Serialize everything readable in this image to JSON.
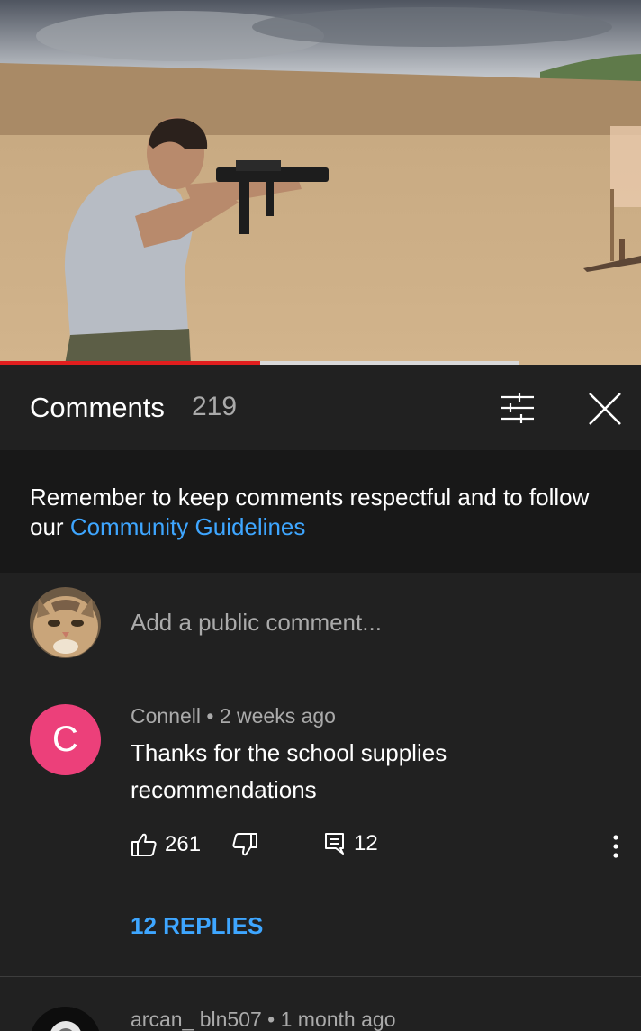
{
  "video": {
    "progress": 0.406,
    "buffered": 0.809
  },
  "comments_header": {
    "title": "Comments",
    "count": "219",
    "filter_icon": "filter-sliders-icon",
    "close_icon": "close-icon"
  },
  "notice": {
    "text": "Remember to keep comments respectful and to follow our ",
    "link": "Community Guidelines"
  },
  "add_comment": {
    "placeholder": "Add a public comment..."
  },
  "comments": [
    {
      "avatar_letter": "C",
      "avatar_color": "#ec407a",
      "meta": "Connell • 2 weeks ago",
      "text": "Thanks for the school supplies recommendations",
      "likes": "261",
      "replies_count": "12",
      "replies_label": "12 REPLIES"
    },
    {
      "meta": "arcan_ bln507 • 1 month ago"
    }
  ],
  "colors": {
    "background": "#212121",
    "notice_bg": "#181818",
    "link": "#3ea6ff",
    "progress": "#e21e1e"
  }
}
